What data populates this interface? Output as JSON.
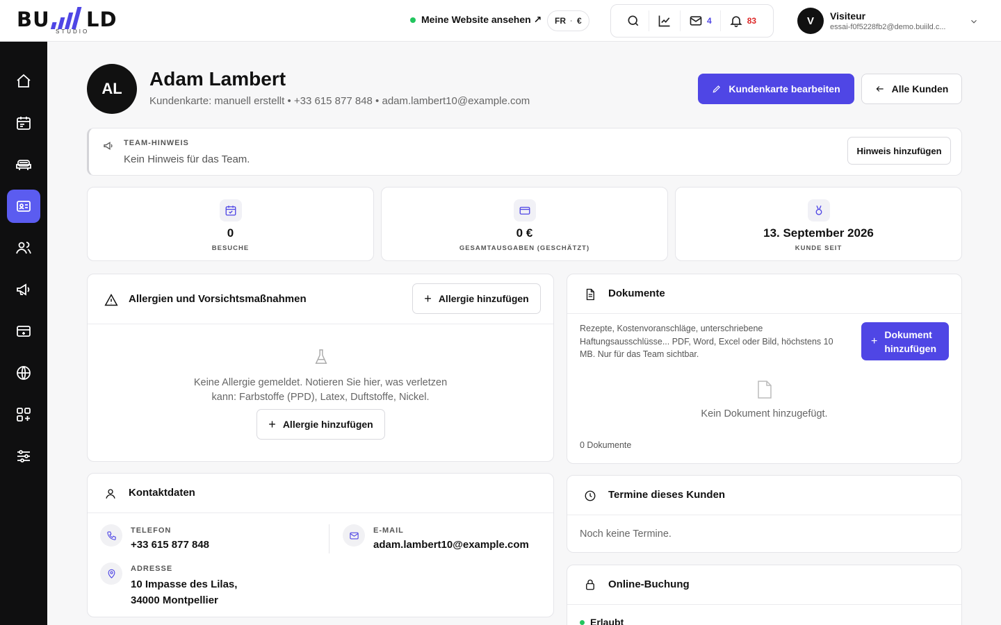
{
  "brand": {
    "logo_text": "BU LD",
    "logo_sub": "STUDIO"
  },
  "topbar": {
    "site_link": "Meine Website ansehen ↗",
    "lang": "FR",
    "currency": "€",
    "mail_count": "4",
    "notif_count": "83",
    "user_initial": "V",
    "user_name": "Visiteur",
    "user_email": "essai-f0f5228fb2@demo.buiild.c..."
  },
  "colors": {
    "accent": "#4f46e5",
    "active_nav": "#5b5cf0",
    "online": "#22c55e",
    "alert": "#dc2626"
  },
  "customer": {
    "initials": "AL",
    "name": "Adam Lambert",
    "meta": "Kundenkarte: manuell erstellt • +33 615 877 848 • adam.lambert10@example.com",
    "edit_button": "Kundenkarte bearbeiten",
    "all_button": "Alle Kunden"
  },
  "team_note": {
    "title": "TEAM-HINWEIS",
    "text": "Kein Hinweis für das Team.",
    "button": "Hinweis hinzufügen"
  },
  "stats": [
    {
      "value": "0",
      "label": "BESUCHE",
      "icon": "calendar-icon"
    },
    {
      "value": "0 €",
      "label": "GESAMTAUSGABEN (GESCHÄTZT)",
      "icon": "card-icon"
    },
    {
      "value": "13. September 2026",
      "label": "KUNDE SEIT",
      "icon": "medal-icon"
    }
  ],
  "allergies": {
    "title": "Allergien und Vorsichtsmaßnahmen",
    "add_button": "Allergie hinzufügen",
    "empty_line1": "Keine Allergie gemeldet. Notieren Sie hier, was verletzen",
    "empty_line2": "kann: Farbstoffe (PPD), Latex, Duftstoffe, Nickel.",
    "empty_button": "Allergie hinzufügen"
  },
  "documents": {
    "title": "Dokumente",
    "desc_line1": "Rezepte, Kostenvoranschläge, unterschriebene",
    "desc_line2": "Haftungsausschlüsse... PDF, Word, Excel oder Bild, höchstens 10",
    "desc_line3": "MB. Nur für das Team sichtbar.",
    "add_line1": "Dokument",
    "add_line2": "hinzufügen",
    "empty": "Kein Dokument hinzugefügt.",
    "count": "0 Dokumente"
  },
  "contact": {
    "title": "Kontaktdaten",
    "phone_label": "TELEFON",
    "phone": "+33 615 877 848",
    "email_label": "E-MAIL",
    "email": "adam.lambert10@example.com",
    "address_label": "ADRESSE",
    "address_line1": "10 Impasse des Lilas,",
    "address_line2": "34000 Montpellier"
  },
  "appointments": {
    "title": "Termine dieses Kunden",
    "empty": "Noch keine Termine."
  },
  "booking": {
    "title": "Online-Buchung",
    "status": "Erlaubt"
  }
}
